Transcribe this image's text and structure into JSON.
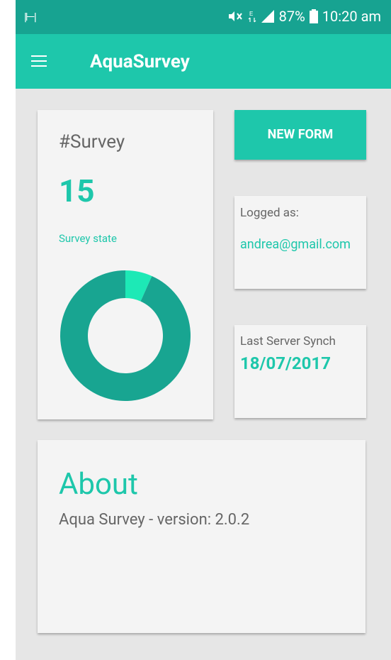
{
  "status_bar": {
    "left_icon": "vibrate-icon",
    "battery_percent": "87%",
    "time": "10:20 am"
  },
  "app_bar": {
    "title": "AquaSurvey",
    "menu_icon": "hamburger-menu-icon"
  },
  "survey_card": {
    "label": "#Survey",
    "count": "15",
    "state_label": "Survey state",
    "chart_data": {
      "type": "pie",
      "donut": true,
      "slices": [
        {
          "value": 1,
          "color": "#1de9b6"
        },
        {
          "value": 14,
          "color": "#18a591"
        }
      ]
    }
  },
  "new_form_button": "NEW FORM",
  "logged_card": {
    "label": "Logged as:",
    "email": "andrea@gmail.com"
  },
  "synch_card": {
    "label": "Last Server Synch",
    "date": "18/07/2017"
  },
  "about_card": {
    "title": "About",
    "version": "Aqua Survey - version: 2.0.2"
  },
  "colors": {
    "status_bar": "#17a391",
    "app_bar": "#1ec7ab",
    "accent": "#1ec7ab",
    "background": "#e6e6e6",
    "card": "#f4f4f4"
  }
}
